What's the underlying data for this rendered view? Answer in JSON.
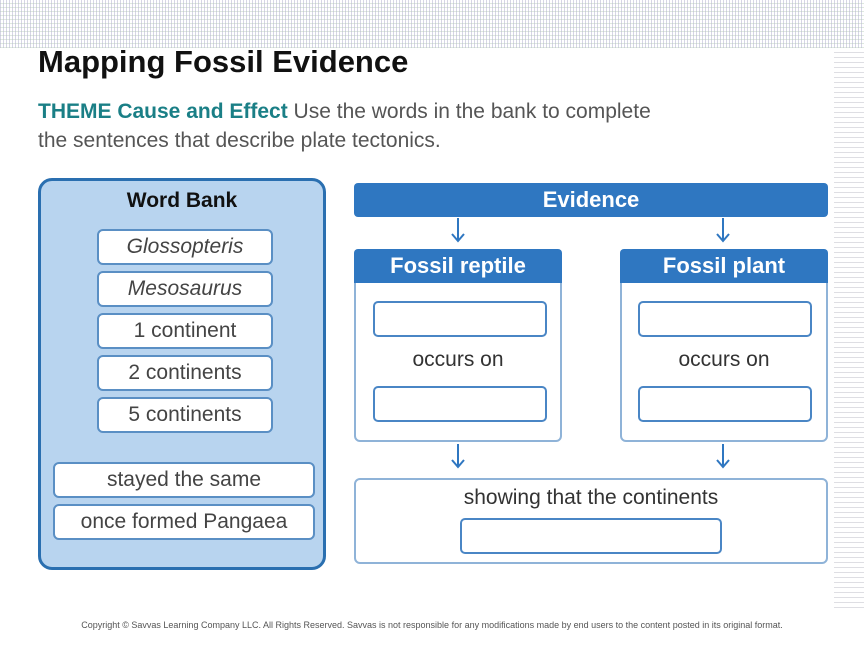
{
  "header": {
    "title": "Mapping Fossil Evidence",
    "theme_label": "THEME Cause and Effect",
    "instructions": " Use the words in the bank to complete the sentences that describe plate tectonics."
  },
  "word_bank": {
    "title": "Word Bank",
    "words": [
      "Glossopteris",
      "Mesosaurus",
      "1 continent",
      "2 continents",
      "5 continents",
      "stayed the same",
      "once formed Pangaea"
    ]
  },
  "diagram": {
    "evidence_label": "Evidence",
    "reptile_label": "Fossil reptile",
    "plant_label": "Fossil plant",
    "occurs_on": "occurs on",
    "result_text": "showing that the continents"
  },
  "footer": {
    "copyright": "Copyright © Savvas Learning Company LLC. All Rights Reserved. Savvas is not responsible for any modifications made by end users to the content posted in its original format."
  },
  "colors": {
    "accent_blue": "#2f77c1",
    "word_bank_bg": "#b8d4ef",
    "theme_teal": "#1a7f86"
  }
}
